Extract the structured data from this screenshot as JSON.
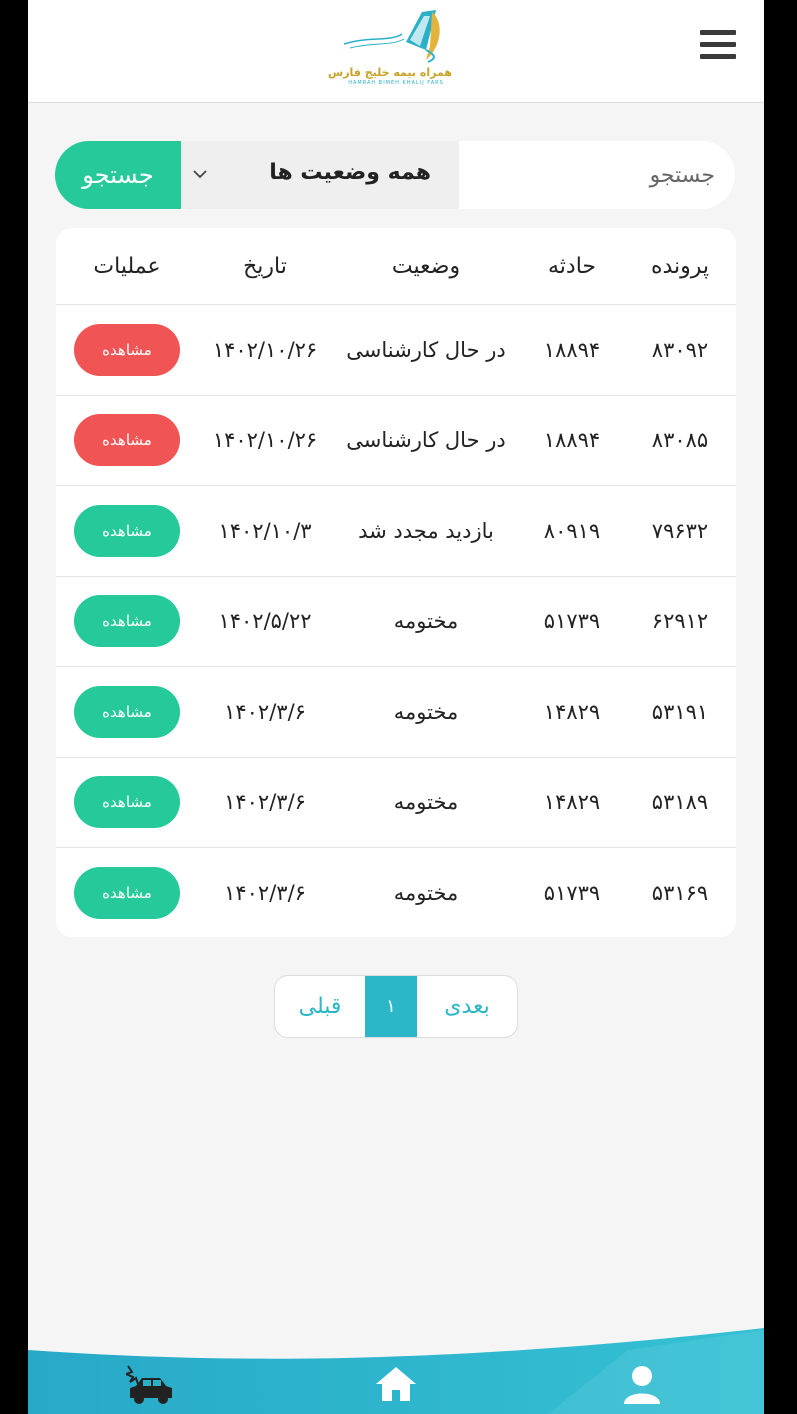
{
  "header": {
    "logo_text": "همراه بیمه خلیج فارس",
    "logo_sub": "HAMRAH BIMEH KHALIJ FARS"
  },
  "search": {
    "placeholder": "جستجو",
    "status_selected": "همه وضعیت ها",
    "button_label": "جستجو"
  },
  "table": {
    "headers": {
      "file": "پرونده",
      "accident": "حادثه",
      "status": "وضعیت",
      "date": "تاریخ",
      "ops": "عملیات"
    },
    "view_label": "مشاهده",
    "rows": [
      {
        "file": "۸۳۰۹۲",
        "accident": "۱۸۸۹۴",
        "status": "در حال کارشناسی",
        "date": "۱۴۰۲/۱۰/۲۶",
        "color": "#f05454"
      },
      {
        "file": "۸۳۰۸۵",
        "accident": "۱۸۸۹۴",
        "status": "در حال کارشناسی",
        "date": "۱۴۰۲/۱۰/۲۶",
        "color": "#f05454"
      },
      {
        "file": "۷۹۶۳۲",
        "accident": "۸۰۹۱۹",
        "status": "بازدید مجدد شد",
        "date": "۱۴۰۲/۱۰/۳",
        "color": "#26c99a"
      },
      {
        "file": "۶۲۹۱۲",
        "accident": "۵۱۷۳۹",
        "status": "مختومه",
        "date": "۱۴۰۲/۵/۲۲",
        "color": "#26c99a"
      },
      {
        "file": "۵۳۱۹۱",
        "accident": "۱۴۸۲۹",
        "status": "مختومه",
        "date": "۱۴۰۲/۳/۶",
        "color": "#26c99a"
      },
      {
        "file": "۵۳۱۸۹",
        "accident": "۱۴۸۲۹",
        "status": "مختومه",
        "date": "۱۴۰۲/۳/۶",
        "color": "#26c99a"
      },
      {
        "file": "۵۳۱۶۹",
        "accident": "۵۱۷۳۹",
        "status": "مختومه",
        "date": "۱۴۰۲/۳/۶",
        "color": "#26c99a"
      }
    ]
  },
  "pagination": {
    "prev": "قبلی",
    "current": "۱",
    "next": "بعدی"
  },
  "bottom_nav": {
    "items": [
      "car-accident-icon",
      "home-icon",
      "user-icon"
    ]
  },
  "colors": {
    "accent_green": "#26c99a",
    "danger_red": "#f05454",
    "teal": "#2bb7c7"
  }
}
